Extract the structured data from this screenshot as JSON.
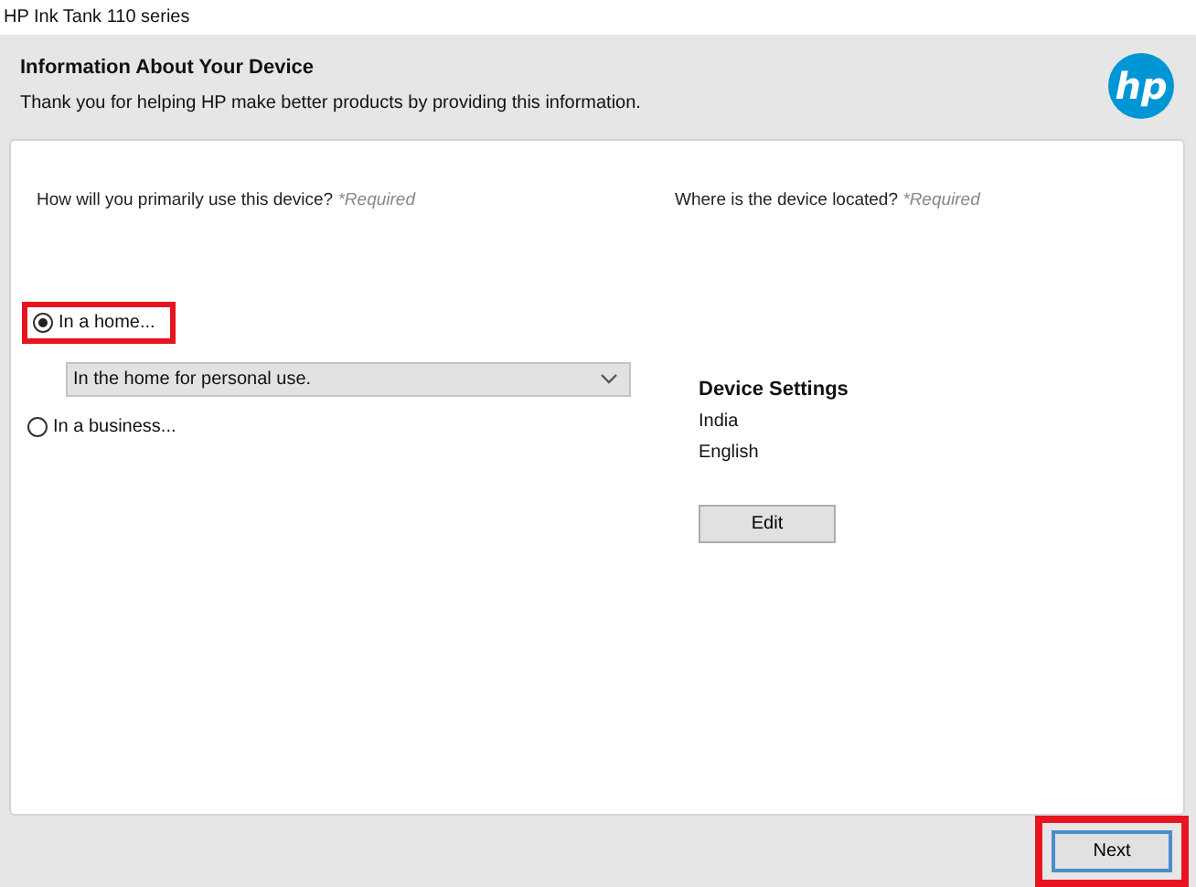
{
  "window": {
    "title": "HP Ink Tank 110 series"
  },
  "header": {
    "title": "Information About Your Device",
    "subtitle": "Thank you for helping HP make better products by providing this information.",
    "logo": "hp"
  },
  "usage": {
    "question": "How will you primarily use this device?",
    "required": "*Required",
    "options": [
      {
        "label": "In a home...",
        "selected": true,
        "highlighted": true
      },
      {
        "label": "In a business...",
        "selected": false,
        "highlighted": false
      }
    ],
    "dropdown": {
      "value": "In the home for personal use."
    }
  },
  "location": {
    "question": "Where is the device located?",
    "required": "*Required",
    "settings_title": "Device Settings",
    "settings": [
      "India",
      "English"
    ],
    "edit_button": "Edit"
  },
  "footer": {
    "next_button": "Next",
    "next_highlighted": true
  }
}
